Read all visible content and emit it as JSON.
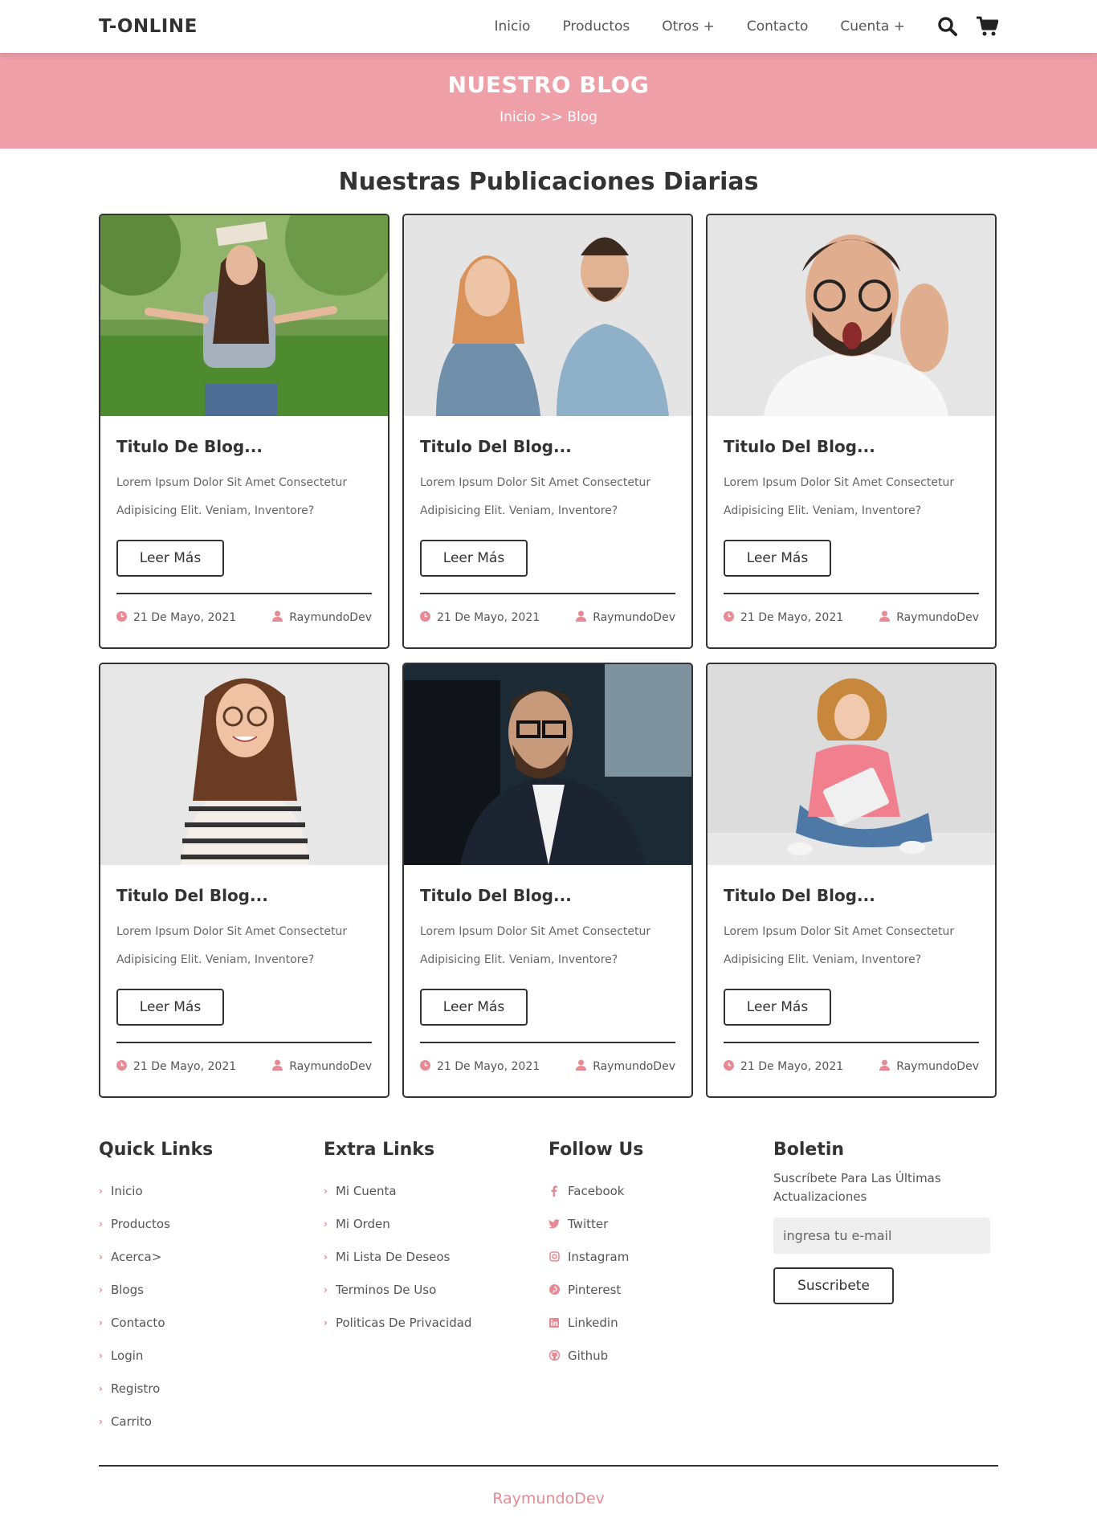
{
  "header": {
    "logo": "T-ONLINE",
    "nav": [
      "Inicio",
      "Productos",
      "Otros +",
      "Contacto",
      "Cuenta +"
    ]
  },
  "hero": {
    "title": "NUESTRO BLOG",
    "breadcrumb": "Inicio >> Blog"
  },
  "section": {
    "title": "Nuestras Publicaciones Diarias"
  },
  "posts": [
    {
      "title": "Titulo De Blog...",
      "text": "Lorem Ipsum Dolor Sit Amet Consectetur Adipisicing Elit. Veniam, Inventore?",
      "button": "Leer Más",
      "date": "21 De Mayo, 2021",
      "author": "RaymundoDev"
    },
    {
      "title": "Titulo Del Blog...",
      "text": "Lorem Ipsum Dolor Sit Amet Consectetur Adipisicing Elit. Veniam, Inventore?",
      "button": "Leer Más",
      "date": "21 De Mayo, 2021",
      "author": "RaymundoDev"
    },
    {
      "title": "Titulo Del Blog...",
      "text": "Lorem Ipsum Dolor Sit Amet Consectetur Adipisicing Elit. Veniam, Inventore?",
      "button": "Leer Más",
      "date": "21 De Mayo, 2021",
      "author": "RaymundoDev"
    },
    {
      "title": "Titulo Del Blog...",
      "text": "Lorem Ipsum Dolor Sit Amet Consectetur Adipisicing Elit. Veniam, Inventore?",
      "button": "Leer Más",
      "date": "21 De Mayo, 2021",
      "author": "RaymundoDev"
    },
    {
      "title": "Titulo Del Blog...",
      "text": "Lorem Ipsum Dolor Sit Amet Consectetur Adipisicing Elit. Veniam, Inventore?",
      "button": "Leer Más",
      "date": "21 De Mayo, 2021",
      "author": "RaymundoDev"
    },
    {
      "title": "Titulo Del Blog...",
      "text": "Lorem Ipsum Dolor Sit Amet Consectetur Adipisicing Elit. Veniam, Inventore?",
      "button": "Leer Más",
      "date": "21 De Mayo, 2021",
      "author": "RaymundoDev"
    }
  ],
  "footer": {
    "quick_links": {
      "title": "Quick Links",
      "items": [
        "Inicio",
        "Productos",
        "Acerca>",
        "Blogs",
        "Contacto",
        "Login",
        "Registro",
        "Carrito"
      ]
    },
    "extra_links": {
      "title": "Extra Links",
      "items": [
        "Mi Cuenta",
        "Mi Orden",
        "Mi Lista De Deseos",
        "Terminos De Uso",
        "Politicas De Privacidad"
      ]
    },
    "follow_us": {
      "title": "Follow Us",
      "items": [
        "Facebook",
        "Twitter",
        "Instagram",
        "Pinterest",
        "Linkedin",
        "Github"
      ]
    },
    "newsletter": {
      "title": "Boletin",
      "text": "Suscríbete Para Las Últimas Actualizaciones",
      "placeholder": "ingresa tu e-mail",
      "button": "Suscribete"
    },
    "credit": "RaymundoDev"
  },
  "colors": {
    "accent": "#ee9fa7",
    "accent_dark": "#e88a93",
    "text": "#333333"
  }
}
